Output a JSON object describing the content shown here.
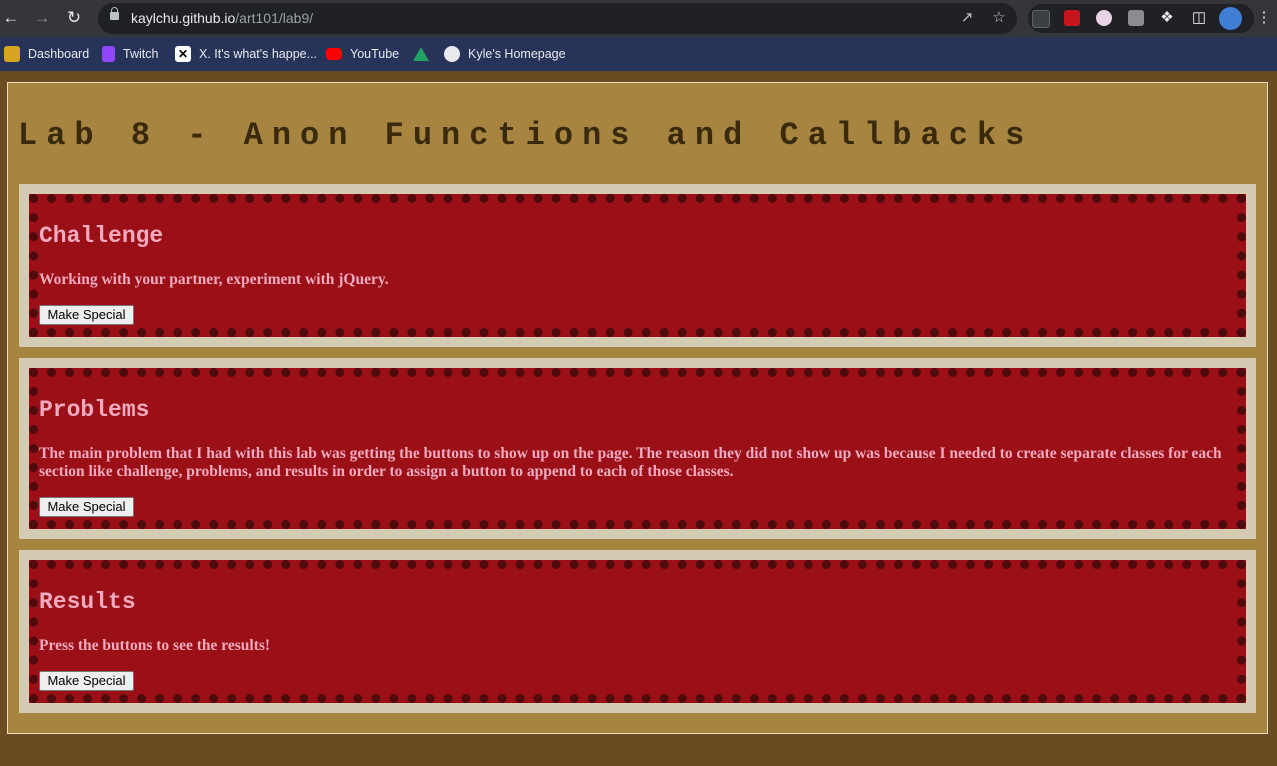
{
  "browser": {
    "url_host": "kaylchu.github.io",
    "url_path": "/art101/lab9/",
    "icons": {
      "back": "arrow-left-icon",
      "forward": "arrow-right-icon",
      "reload": "reload-icon",
      "lock": "lock-icon",
      "share": "share-icon",
      "bookmark": "star-icon",
      "extensions": "puzzle-icon",
      "side_panel": "side-panel-icon",
      "menu": "kebab-menu-icon"
    },
    "bookmarks": [
      {
        "label": "Dashboard",
        "color": "#d8a31e"
      },
      {
        "label": "Twitch",
        "color": "#9146ff"
      },
      {
        "label": "X. It's what's happe...",
        "color": "#000000"
      },
      {
        "label": "YouTube",
        "color": "#ff0000"
      },
      {
        "label": "",
        "color": "#1fa463"
      },
      {
        "label": "Kyle's Homepage",
        "color": "#e8eaed"
      }
    ]
  },
  "page": {
    "title": "Lab 8 - Anon Functions and Callbacks",
    "colors": {
      "background": "#694c22",
      "frame": "#a78540",
      "section_bg": "#9b1016",
      "dots": "#4e0a0c",
      "text": "#f1aabf"
    },
    "sections": [
      {
        "title": "Challenge",
        "text": "Working with your partner, experiment with jQuery.",
        "button": "Make Special"
      },
      {
        "title": "Problems",
        "text": "The main problem that I had with this lab was getting the buttons to show up on the page. The reason they did not show up was because I needed to create separate classes for each section like challenge, problems, and results in order to assign a button to append to each of those classes.",
        "button": "Make Special"
      },
      {
        "title": "Results",
        "text": "Press the buttons to see the results!",
        "button": "Make Special"
      }
    ]
  }
}
